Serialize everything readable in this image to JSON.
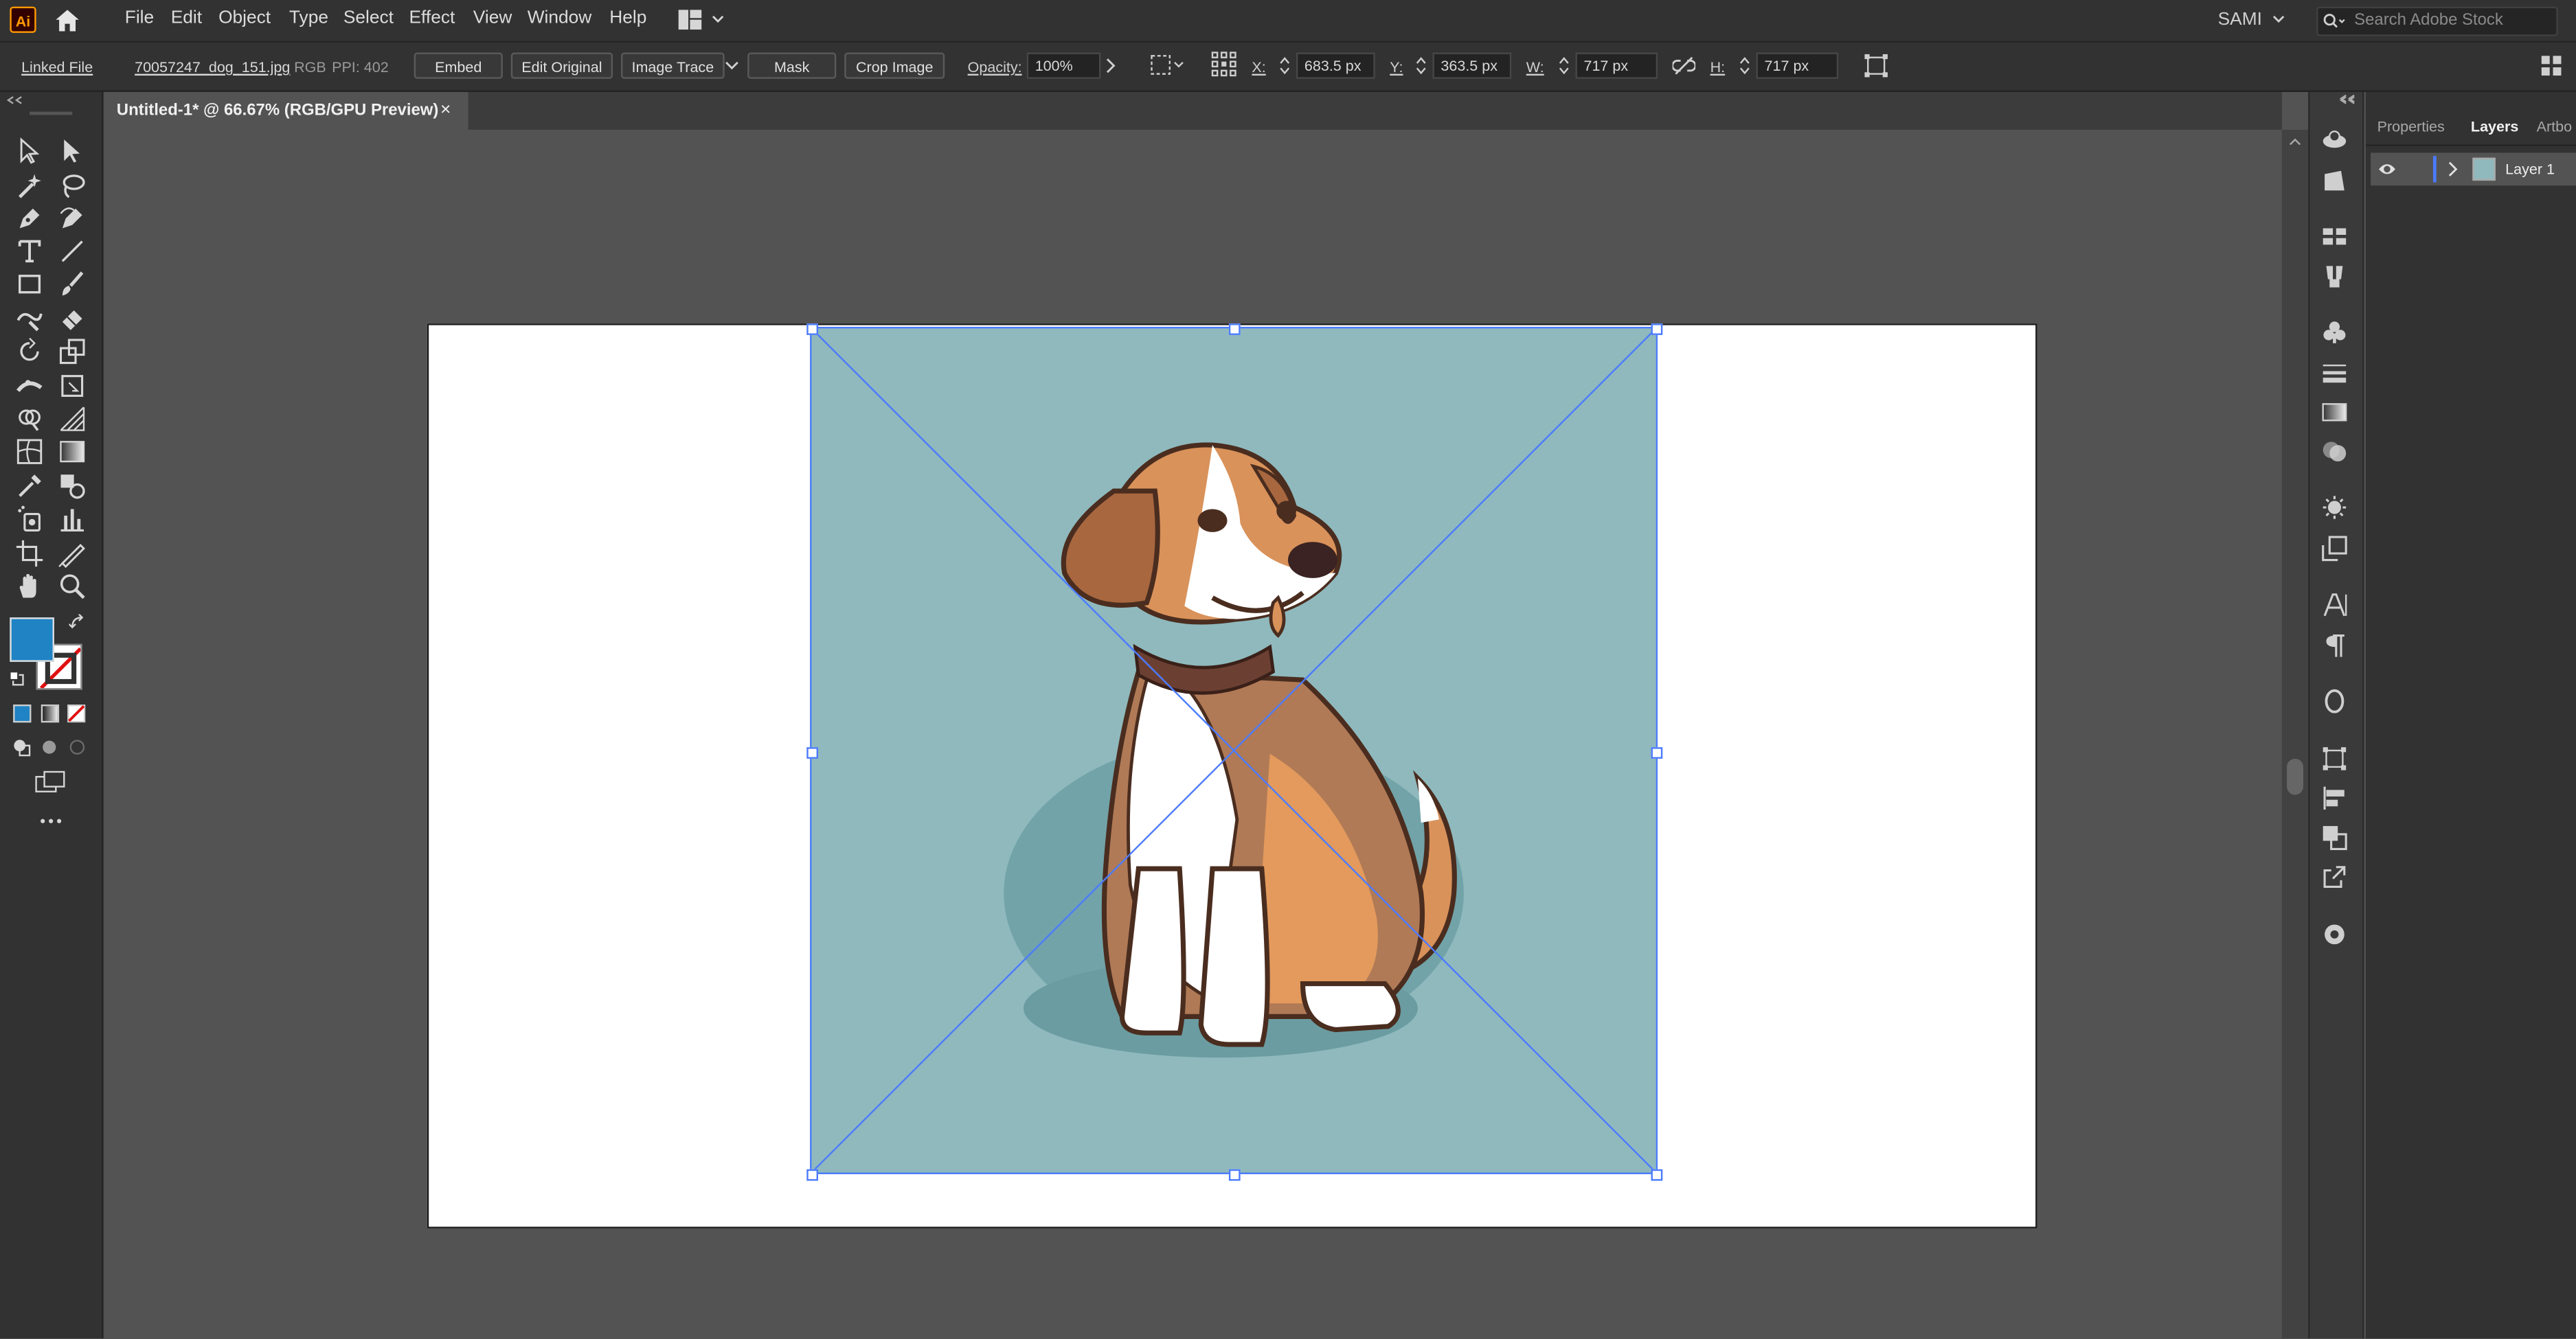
{
  "menubar": {
    "app_logo": "Ai",
    "items": [
      "File",
      "Edit",
      "Object",
      "Type",
      "Select",
      "Effect",
      "View",
      "Window",
      "Help"
    ],
    "user": "SAMI",
    "search_placeholder": "Search Adobe Stock"
  },
  "controlbar": {
    "linked_file": "Linked File",
    "file_name": "70057247_dog_151.jpg",
    "color_mode": "RGB",
    "ppi": "PPI: 402",
    "embed": "Embed",
    "edit_original": "Edit Original",
    "image_trace": "Image Trace",
    "mask": "Mask",
    "crop_image": "Crop Image",
    "opacity_label": "Opacity:",
    "opacity_value": "100%",
    "x_label": "X:",
    "x_value": "683.5 px",
    "y_label": "Y:",
    "y_value": "363.5 px",
    "w_label": "W:",
    "w_value": "717 px",
    "h_label": "H:",
    "h_value": "717 px"
  },
  "document": {
    "tab_title": "Untitled-1* @ 66.67% (RGB/GPU Preview)",
    "close": "×"
  },
  "panel": {
    "tabs": [
      "Properties",
      "Layers",
      "Artbo"
    ],
    "active_tab": "Layers",
    "layers": [
      {
        "name": "Layer 1"
      }
    ]
  },
  "colors": {
    "fill": "#1f83c4",
    "selection": "#4b7bff",
    "image_bg": "#8fb9bd"
  }
}
